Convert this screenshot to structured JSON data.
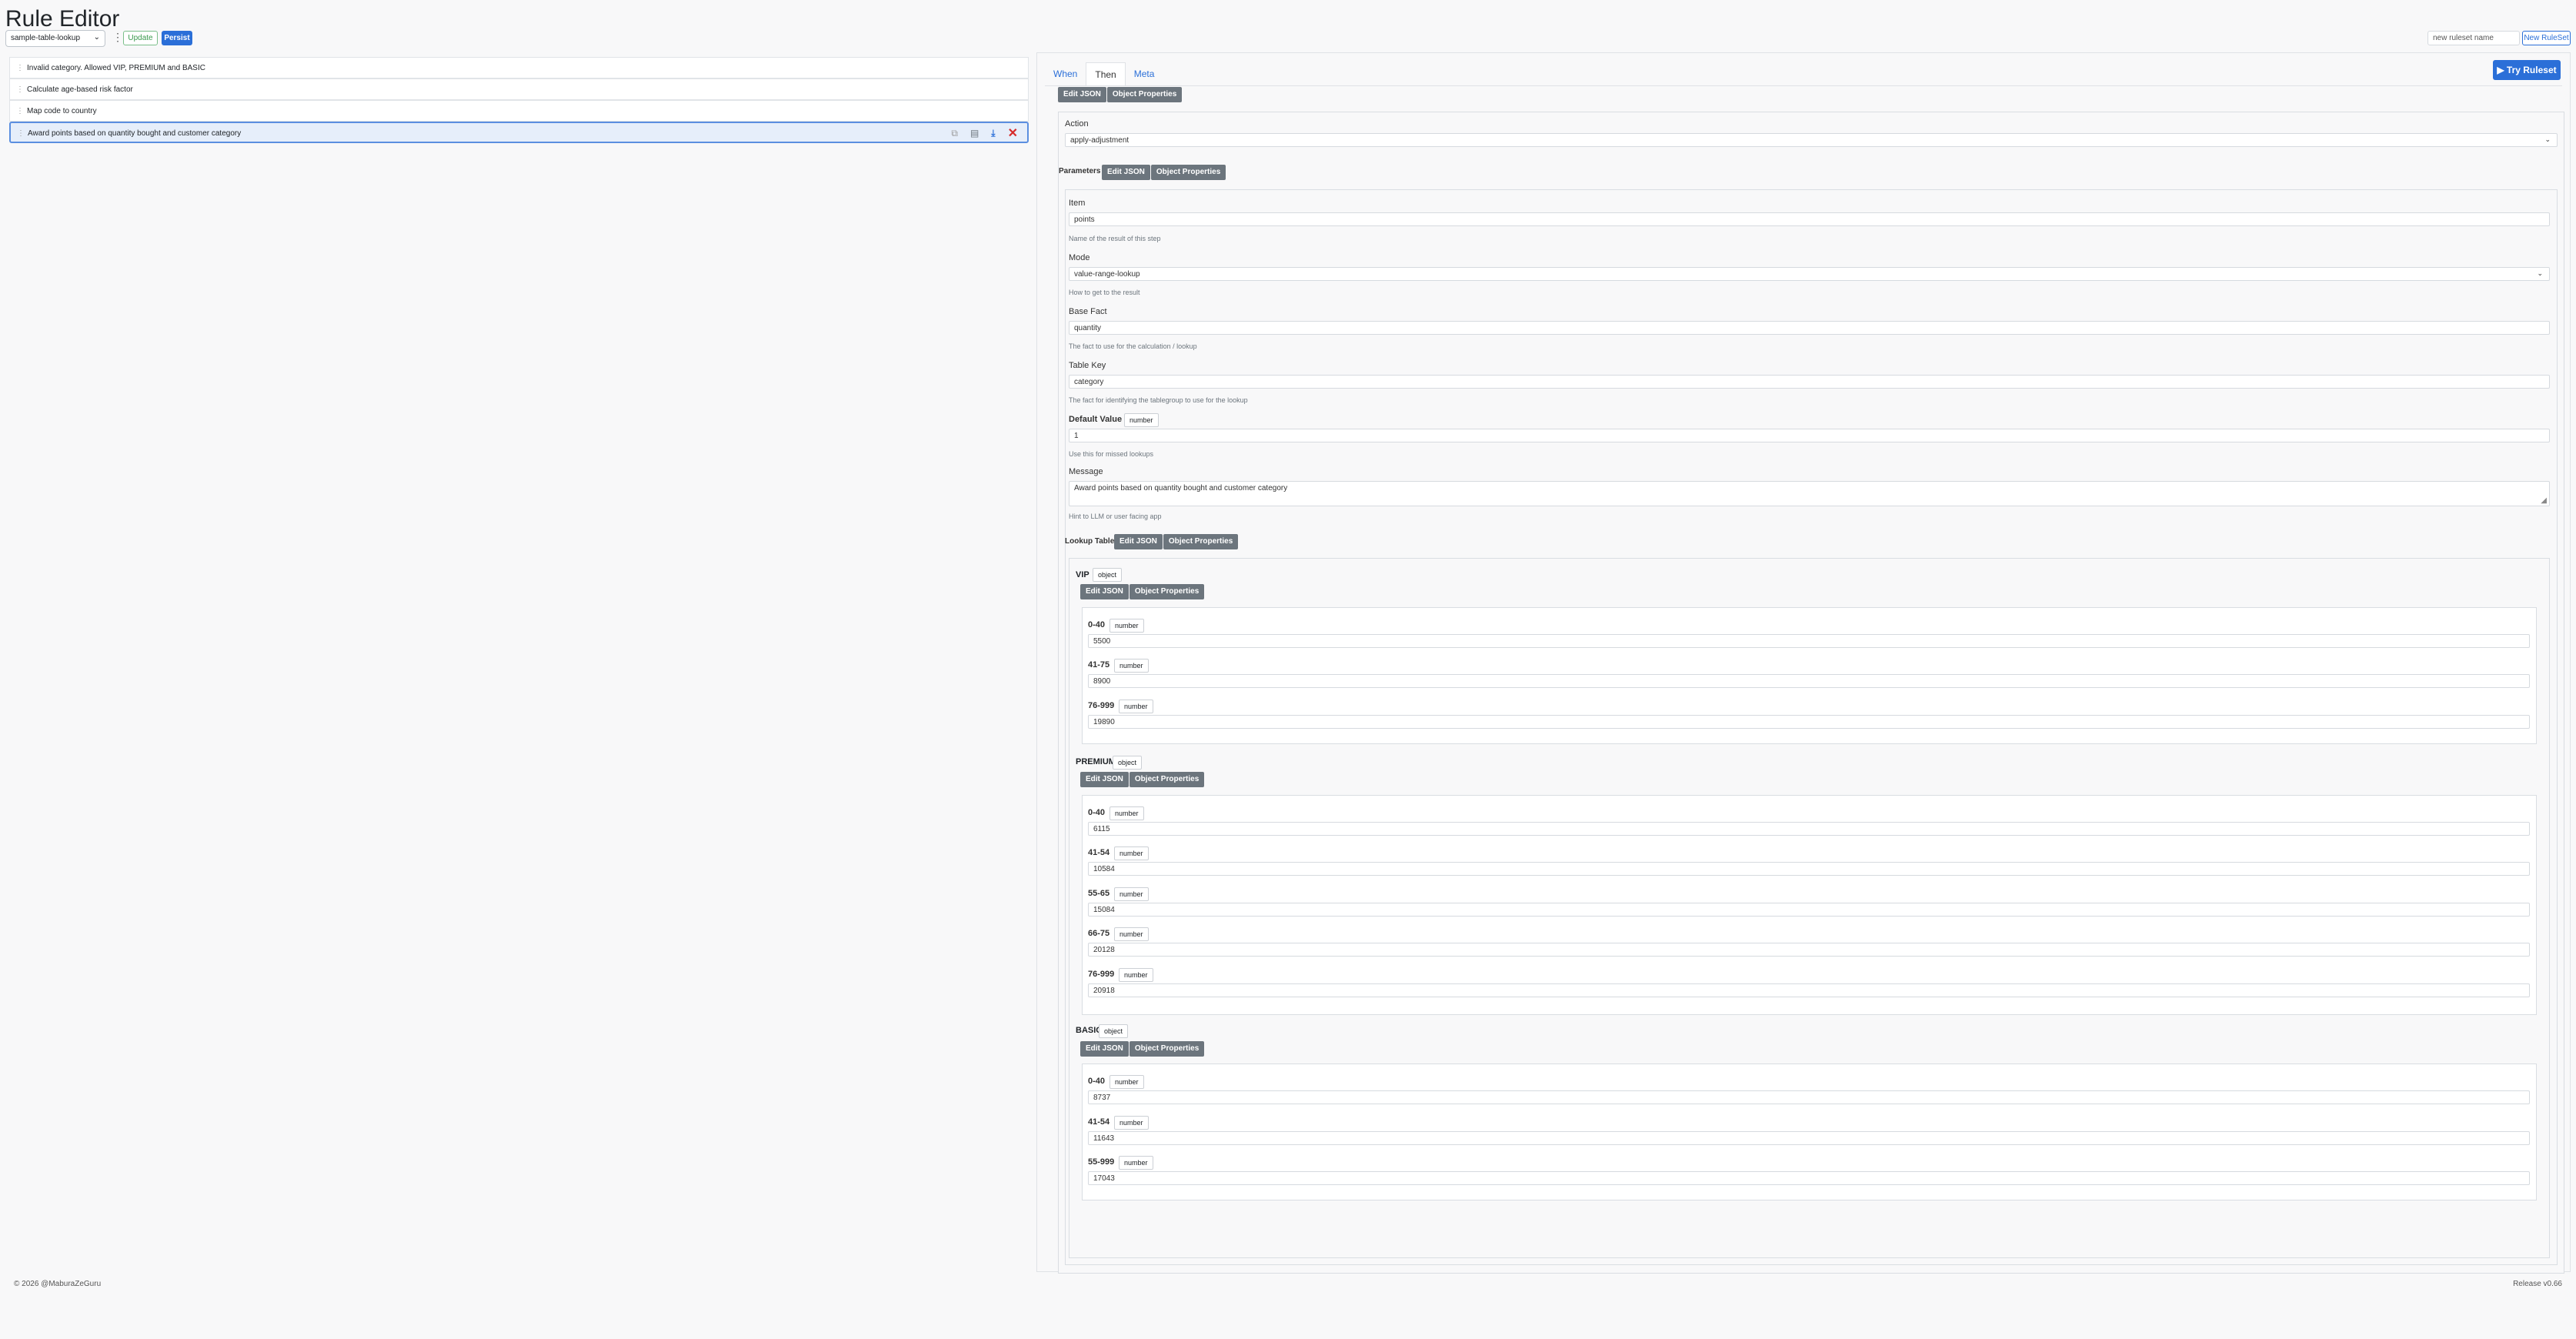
{
  "app": {
    "title": "Rule Editor"
  },
  "header": {
    "ruleset_select": "sample-table-lookup",
    "update_label": "Update",
    "persist_label": "Persist",
    "ruleset_name_placeholder": "new ruleset name",
    "new_ruleset_label": "New RuleSet"
  },
  "rules": [
    {
      "label": "Invalid category. Allowed VIP, PREMIUM and BASIC"
    },
    {
      "label": "Calculate age-based risk factor"
    },
    {
      "label": "Map code to country"
    },
    {
      "label": "Award points based on quantity bought and customer category"
    }
  ],
  "editor": {
    "tabs": [
      "When",
      "Then",
      "Meta"
    ],
    "active_tab": "Then",
    "try_label": "▶ Try Ruleset",
    "edit_json": "Edit JSON",
    "object_properties": "Object Properties",
    "action_label": "Action",
    "action_value": "apply-adjustment",
    "parameters_label": "Parameters",
    "item": {
      "label": "Item",
      "value": "points",
      "help": "Name of the result of this step"
    },
    "mode": {
      "label": "Mode",
      "value": "value-range-lookup",
      "help": "How to get to the result"
    },
    "base_fact": {
      "label": "Base Fact",
      "value": "quantity",
      "help": "The fact to use for the calculation / lookup"
    },
    "table_key": {
      "label": "Table Key",
      "value": "category",
      "help": "The fact for identifying the tablegroup to use for the lookup"
    },
    "default_value": {
      "label": "Default Value",
      "type": "number",
      "value": "1",
      "help": "Use this for missed lookups"
    },
    "message": {
      "label": "Message",
      "value": "Award points based on quantity bought and customer category",
      "help": "Hint to LLM or user facing app"
    },
    "lookup_table_label": "Lookup Table",
    "object_type": "object",
    "number_type": "number",
    "groups": [
      {
        "name": "VIP",
        "rows": [
          {
            "range": "0-40",
            "value": "5500"
          },
          {
            "range": "41-75",
            "value": "8900"
          },
          {
            "range": "76-999",
            "value": "19890"
          }
        ]
      },
      {
        "name": "PREMIUM",
        "rows": [
          {
            "range": "0-40",
            "value": "6115"
          },
          {
            "range": "41-54",
            "value": "10584"
          },
          {
            "range": "55-65",
            "value": "15084"
          },
          {
            "range": "66-75",
            "value": "20128"
          },
          {
            "range": "76-999",
            "value": "20918"
          }
        ]
      },
      {
        "name": "BASIC",
        "rows": [
          {
            "range": "0-40",
            "value": "8737"
          },
          {
            "range": "41-54",
            "value": "11643"
          },
          {
            "range": "55-999",
            "value": "17043"
          }
        ]
      }
    ]
  },
  "footer": {
    "copyright": "© 2026 @MaburaZeGuru",
    "release": "Release v0.66"
  }
}
